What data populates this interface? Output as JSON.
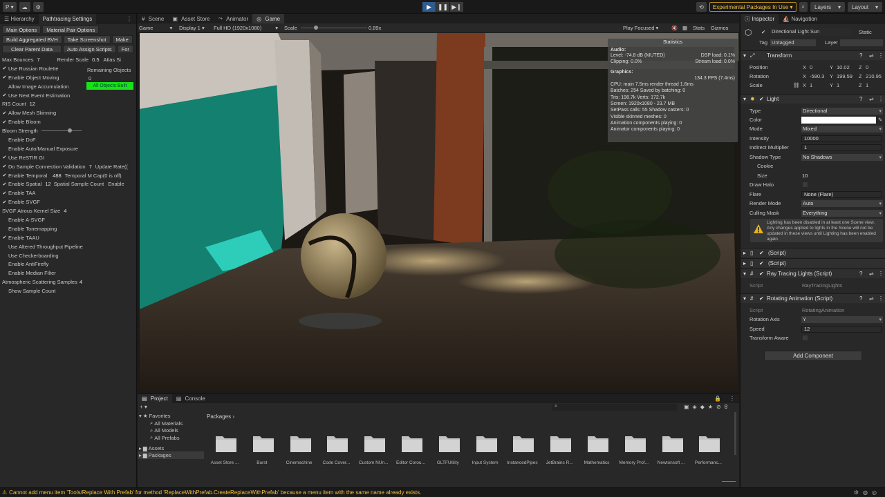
{
  "toolbar": {
    "account_label": "P",
    "play_icon": "play-icon",
    "experimental_label": "Experimental Packages In Use",
    "layers_label": "Layers",
    "layout_label": "Layout"
  },
  "left_panel": {
    "tabs": [
      "Hierarchy",
      "Pathtracing Settings"
    ],
    "option_tabs": [
      "Main Options",
      "Material Pair Options"
    ],
    "buttons_row1": [
      "Build Aggregated BVH",
      "Take Screenshot",
      "Make"
    ],
    "buttons_row2": [
      "Clear Parent Data",
      "Auto Assign Scripts",
      "For"
    ],
    "max_bounces_label": "Max Bounces",
    "max_bounces_value": "7",
    "render_scale_label": "Render Scale",
    "render_scale_value": "0.5",
    "atlas_label": "Atlas Si",
    "remaining_label": "Remaining Objects",
    "remaining_value": "0",
    "all_built_label": "All Objects Built",
    "options": [
      {
        "label": "Use Russian Roulette",
        "checked": true
      },
      {
        "label": "Enable Object Moving",
        "checked": true
      },
      {
        "label": "Allow Image Accumulation",
        "checked": false
      },
      {
        "label": "Use Next Event Estimation",
        "checked": true
      }
    ],
    "ris_count_label": "RIS Count",
    "ris_count_value": "12",
    "options2": [
      {
        "label": "Allow Mesh Skinning",
        "checked": true
      },
      {
        "label": "Enable Bloom",
        "checked": true
      }
    ],
    "bloom_strength_label": "Bloom Strength",
    "options3": [
      {
        "label": "Enable DoF",
        "checked": false
      },
      {
        "label": "Enable Auto/Manual Exposure",
        "checked": false
      },
      {
        "label": "Use ReSTIR GI",
        "checked": true
      },
      {
        "label": "Do Sample Connection Validation",
        "checked": true,
        "extra_num": "7",
        "extra_label": "Update Rate(("
      },
      {
        "label": "Enable Temporal",
        "checked": true,
        "extra_num": "488",
        "extra_label": "Temporal M Cap(0 is off)"
      },
      {
        "label": "Enable Spatial",
        "checked": true,
        "extra_num": "12",
        "extra_label": "Spatial Sample Count",
        "extra_label2": "Enable"
      },
      {
        "label": "Enable TAA",
        "checked": true
      },
      {
        "label": "Enable SVGF",
        "checked": true
      }
    ],
    "svgf_kernel_label": "SVGF Atrous Kernel Size",
    "svgf_kernel_value": "4",
    "options4": [
      {
        "label": "Enable A-SVGF",
        "checked": false
      },
      {
        "label": "Enable Tonemapping",
        "checked": false
      },
      {
        "label": "Enable TAAU",
        "checked": true
      },
      {
        "label": "Use Altered Throughput Pipeline",
        "checked": false
      },
      {
        "label": "Use Checkerboarding",
        "checked": false
      },
      {
        "label": "Enable AntiFirefly",
        "checked": false
      },
      {
        "label": "Enable Median Filter",
        "checked": false
      }
    ],
    "atmo_label": "Atmospheric Scattering Samples",
    "atmo_value": "4",
    "show_sample_label": "Show Sample Count"
  },
  "center": {
    "tabs": [
      "Scene",
      "Asset Store",
      "Animator",
      "Game"
    ],
    "game_dropdown": "Game",
    "display_dropdown": "Display 1",
    "resolution_dropdown": "Full HD (1920x1080)",
    "scale_label": "Scale",
    "scale_value": "0.89x",
    "scale_fraction": 0.2,
    "play_focused": "Play Focused",
    "stats_label": "Stats",
    "gizmos_label": "Gizmos"
  },
  "stats": {
    "title": "Statistics",
    "audio_header": "Audio:",
    "level": "Level: -74.8 dB (MUTED)",
    "dsp": "DSP load: 0.1%",
    "clipping": "Clipping: 0.0%",
    "stream": "Stream load: 0.0%",
    "graphics_header": "Graphics:",
    "fps": "134.3 FPS (7.4ms)",
    "cpu": "CPU: main 7.5ms  render thread 1.6ms",
    "batches": "Batches: 254   Saved by batching: 0",
    "tris": "Tris: 198.7k     Verts: 172.7k",
    "screen": "Screen: 1920x1080 - 23.7 MB",
    "setpass": "SetPass calls: 55          Shadow casters: 0",
    "skinned": "Visible skinned meshes: 0",
    "anim": "Animation components playing: 0",
    "animator": "Animator components playing: 0"
  },
  "inspector": {
    "tabs": [
      "Inspector",
      "Navigation"
    ],
    "object_name": "Directional Light Sun",
    "static_label": "Static",
    "tag_label": "Tag",
    "tag_value": "Untagged",
    "layer_label": "Layer",
    "transform_label": "Transform",
    "position_label": "Position",
    "position": {
      "x": "0",
      "y": "10.02",
      "z": "0"
    },
    "rotation_label": "Rotation",
    "rotation": {
      "x": "-590.3",
      "y": "199.59",
      "z": "210.95"
    },
    "scale_label": "Scale",
    "scale": {
      "x": "1",
      "y": "1",
      "z": "1"
    },
    "light_label": "Light",
    "type_label": "Type",
    "type_value": "Directional",
    "color_label": "Color",
    "color_value": "#ffffff",
    "mode_label": "Mode",
    "mode_value": "Mixed",
    "intensity_label": "Intensity",
    "intensity_value": "10000",
    "indirect_label": "Indirect Multiplier",
    "indirect_value": "1",
    "shadow_label": "Shadow Type",
    "shadow_value": "No Shadows",
    "cookie_label": "Cookie",
    "size_label": "Size",
    "size_value": "10",
    "halo_label": "Draw Halo",
    "flare_label": "Flare",
    "flare_value": "None (Flare)",
    "render_mode_label": "Render Mode",
    "render_mode_value": "Auto",
    "culling_label": "Culling Mask",
    "culling_value": "Everything",
    "warning_text": "Lighting has been disabled in at least one Scene view. Any changes applied to lights in the Scene will not be updated in these views until Lighting has been enabled again.",
    "script1": "(Script)",
    "script2": "(Script)",
    "rtl_label": "Ray Tracing Lights (Script)",
    "script_label": "Script",
    "rtl_script": "RayTracingLights",
    "rot_anim_label": "Rotating Animation (Script)",
    "rot_script": "RotatingAnimation",
    "rot_axis_label": "Rotation Axis",
    "rot_axis_value": "Y",
    "speed_label": "Speed",
    "speed_value": "12",
    "transform_aware_label": "Transform Aware",
    "add_component": "Add Component"
  },
  "bottom": {
    "tabs": [
      "Project",
      "Console"
    ],
    "tree": [
      "Favorites",
      "All Materials",
      "All Models",
      "All Prefabs",
      "Assets",
      "Packages"
    ],
    "crumb": "Packages",
    "folders": [
      "Asset Store ...",
      "Burst",
      "Cinemachine",
      "Code Cover...",
      "Custom NUn...",
      "Editor Corou...",
      "GLTFUtility",
      "Input System",
      "InstancedPipes",
      "JetBrains R...",
      "Mathematics",
      "Memory Prof...",
      "Newtonsoft ...",
      "Performanc..."
    ]
  },
  "status": {
    "message": "Cannot add menu item 'Tools/Replace With Prefab' for method 'ReplaceWithPrefab.CreateReplaceWithPrefab' because a menu item with the same name already exists."
  }
}
